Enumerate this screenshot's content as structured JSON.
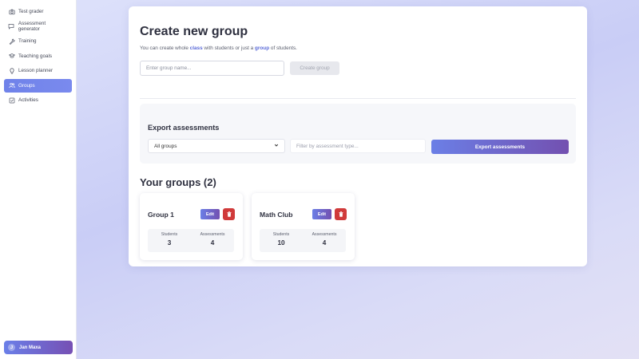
{
  "sidebar": {
    "items": [
      {
        "label": "Test grader",
        "icon": "camera-icon",
        "active": false
      },
      {
        "label": "Assessment generator",
        "icon": "chat-bubble-icon",
        "active": false
      },
      {
        "label": "Training",
        "icon": "wrench-icon",
        "active": false
      },
      {
        "label": "Teaching goals",
        "icon": "graduation-cap-icon",
        "active": false
      },
      {
        "label": "Lesson planner",
        "icon": "lightbulb-icon",
        "active": false
      },
      {
        "label": "Groups",
        "icon": "users-icon",
        "active": true
      },
      {
        "label": "Activities",
        "icon": "checkbox-icon",
        "active": false
      }
    ],
    "user": {
      "initial": "J",
      "name": "Jan Maxa"
    }
  },
  "create": {
    "title": "Create new group",
    "subtitle_pre": "You can create whole ",
    "subtitle_class": "class",
    "subtitle_mid": " with students or just a ",
    "subtitle_group": "group",
    "subtitle_post": " of students.",
    "input_placeholder": "Enter group name...",
    "button_label": "Create group"
  },
  "export": {
    "title": "Export assessments",
    "select_value": "All groups",
    "filter_placeholder": "Filter by assessment type...",
    "button_label": "Export assessments"
  },
  "groups": {
    "heading": "Your groups (2)",
    "edit_label": "Edit",
    "students_label": "Students",
    "assessments_label": "Assessments",
    "items": [
      {
        "name": "Group 1",
        "students": "3",
        "assessments": "4"
      },
      {
        "name": "Math Club",
        "students": "10",
        "assessments": "4"
      }
    ]
  },
  "colors": {
    "accent": "#6f82e9",
    "accent_end": "#7350b0",
    "danger": "#d03a3a"
  }
}
